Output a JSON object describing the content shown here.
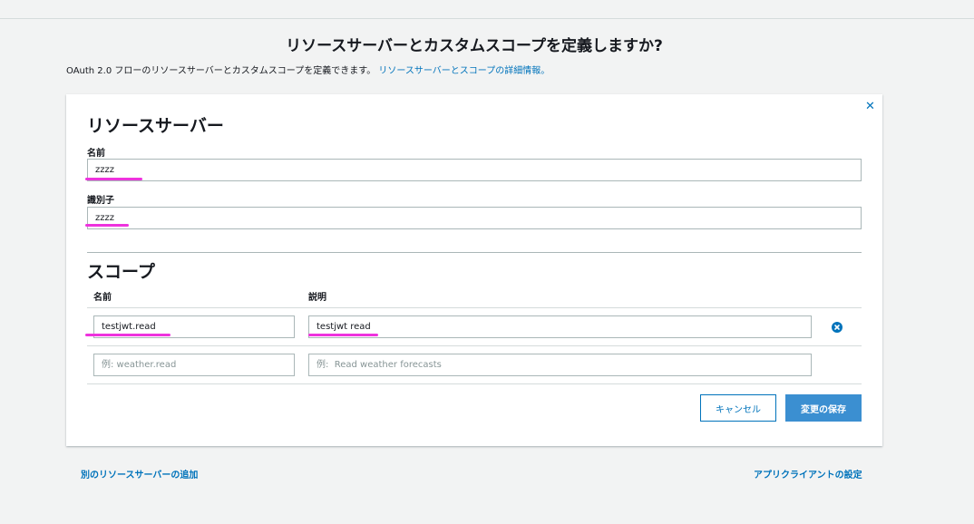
{
  "header": {
    "title": "リソースサーバーとカスタムスコープを定義しますか?",
    "description": "OAuth 2.0 フローのリソースサーバーとカスタムスコープを定義できます。",
    "learn_more_link": "リソースサーバーとスコープの詳細情報。"
  },
  "resource_server": {
    "section_title": "リソースサーバー",
    "name_label": "名前",
    "name_value": "zzzz",
    "identifier_label": "識別子",
    "identifier_value": "zzzz"
  },
  "scopes": {
    "section_title": "スコープ",
    "columns": {
      "name": "名前",
      "description": "説明"
    },
    "rows": [
      {
        "name": "testjwt.read",
        "description": "testjwt read"
      }
    ],
    "new_row": {
      "name_placeholder": "例: weather.read",
      "description_placeholder": "例:  Read weather forecasts"
    }
  },
  "buttons": {
    "cancel": "キャンセル",
    "save": "変更の保存"
  },
  "footer": {
    "add_resource_server": "別のリソースサーバーの追加",
    "app_client_settings": "アプリクライアントの設定"
  },
  "icons": {
    "close": "close-icon",
    "remove_scope": "remove-circle-icon"
  },
  "colors": {
    "link": "#0073bb",
    "primary_button": "#3b8fd1",
    "highlight": "#ee33dd"
  }
}
